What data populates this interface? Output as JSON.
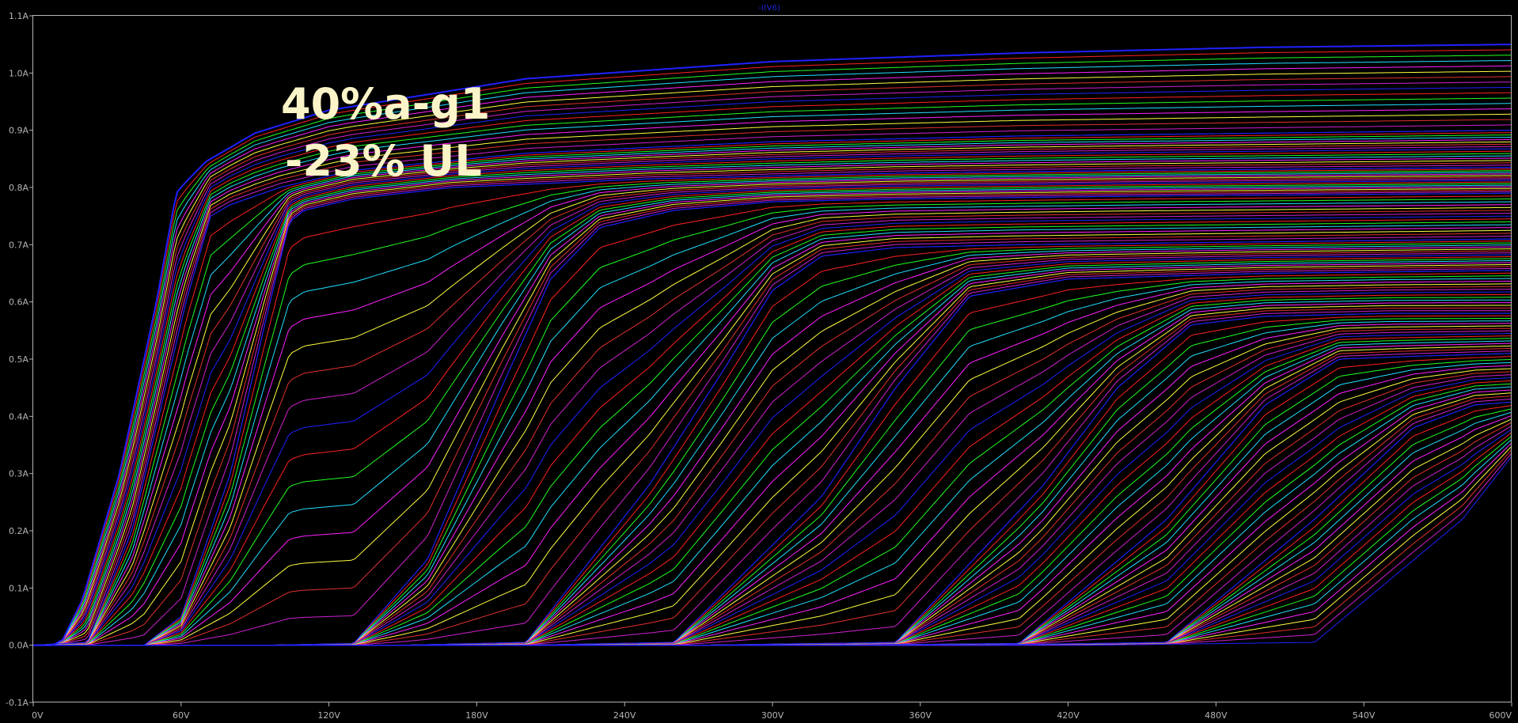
{
  "chart_data": {
    "type": "line",
    "trace_label": "-I(V6)",
    "xlabel": "",
    "ylabel": "",
    "xlim": [
      0,
      600
    ],
    "ylim": [
      -0.1,
      1.1
    ],
    "grid": false,
    "x_ticks": [
      {
        "value": 0,
        "label": "0V"
      },
      {
        "value": 60,
        "label": "60V"
      },
      {
        "value": 120,
        "label": "120V"
      },
      {
        "value": 180,
        "label": "180V"
      },
      {
        "value": 240,
        "label": "240V"
      },
      {
        "value": 300,
        "label": "300V"
      },
      {
        "value": 360,
        "label": "360V"
      },
      {
        "value": 420,
        "label": "420V"
      },
      {
        "value": 480,
        "label": "480V"
      },
      {
        "value": 540,
        "label": "540V"
      },
      {
        "value": 600,
        "label": "600V"
      }
    ],
    "y_ticks": [
      {
        "value": -0.1,
        "label": "-0.1A"
      },
      {
        "value": 0.0,
        "label": "0.0A"
      },
      {
        "value": 0.1,
        "label": "0.1A"
      },
      {
        "value": 0.2,
        "label": "0.2A"
      },
      {
        "value": 0.3,
        "label": "0.3A"
      },
      {
        "value": 0.4,
        "label": "0.4A"
      },
      {
        "value": 0.5,
        "label": "0.5A"
      },
      {
        "value": 0.6,
        "label": "0.6A"
      },
      {
        "value": 0.7,
        "label": "0.7A"
      },
      {
        "value": 0.8,
        "label": "0.8A"
      },
      {
        "value": 0.9,
        "label": "0.9A"
      },
      {
        "value": 1.0,
        "label": "1.0A"
      },
      {
        "value": 1.1,
        "label": "1.1A"
      }
    ],
    "annotations": [
      "40%a-g1",
      "-23% UL"
    ],
    "trace_colors": [
      "#2020ff",
      "#ff2020",
      "#20ff20",
      "#20e0ff",
      "#ff20ff",
      "#ffff40",
      "#e03030",
      "#d020d0"
    ],
    "series": [
      {
        "x": [
          0,
          8,
          12,
          20,
          35,
          50,
          58,
          62,
          70,
          90,
          120,
          200,
          300,
          400,
          500,
          600
        ],
        "y": [
          0,
          0,
          0.01,
          0.08,
          0.3,
          0.6,
          0.79,
          0.81,
          0.845,
          0.895,
          0.935,
          0.99,
          1.02,
          1.035,
          1.045,
          1.05
        ]
      },
      {
        "x": [
          0,
          22,
          40,
          62,
          72,
          80,
          100,
          130,
          200,
          300,
          400,
          500,
          600
        ],
        "y": [
          0,
          0.005,
          0.2,
          0.6,
          0.75,
          0.77,
          0.8,
          0.83,
          0.86,
          0.88,
          0.89,
          0.895,
          0.9
        ]
      },
      {
        "x": [
          0,
          45,
          60,
          80,
          95,
          104,
          110,
          130,
          170,
          250,
          350,
          450,
          600
        ],
        "y": [
          0,
          0,
          0.05,
          0.3,
          0.58,
          0.74,
          0.76,
          0.78,
          0.8,
          0.815,
          0.825,
          0.83,
          0.835
        ]
      },
      {
        "x": [
          0,
          95,
          130,
          160,
          190,
          210,
          230,
          260,
          300,
          350,
          450,
          600
        ],
        "y": [
          0,
          0,
          0.003,
          0.15,
          0.45,
          0.64,
          0.73,
          0.76,
          0.775,
          0.78,
          0.785,
          0.79
        ]
      },
      {
        "x": [
          0,
          150,
          200,
          250,
          280,
          300,
          320,
          350,
          400,
          500,
          600
        ],
        "y": [
          0,
          0,
          0.005,
          0.28,
          0.48,
          0.62,
          0.68,
          0.695,
          0.7,
          0.705,
          0.71
        ]
      },
      {
        "x": [
          0,
          200,
          260,
          320,
          350,
          380,
          420,
          500,
          600
        ],
        "y": [
          0,
          0,
          0.005,
          0.26,
          0.45,
          0.61,
          0.64,
          0.65,
          0.655
        ]
      },
      {
        "x": [
          0,
          270,
          350,
          410,
          440,
          470,
          500,
          550,
          600
        ],
        "y": [
          0,
          0,
          0.005,
          0.28,
          0.45,
          0.56,
          0.575,
          0.58,
          0.58
        ]
      },
      {
        "x": [
          0,
          320,
          400,
          460,
          500,
          530,
          560,
          600
        ],
        "y": [
          0,
          0,
          0.003,
          0.22,
          0.42,
          0.5,
          0.505,
          0.51
        ]
      },
      {
        "x": [
          0,
          380,
          460,
          520,
          560,
          585,
          600
        ],
        "y": [
          0,
          0,
          0.005,
          0.22,
          0.38,
          0.42,
          0.425
        ]
      },
      {
        "x": [
          0,
          430,
          520,
          580,
          600
        ],
        "y": [
          0,
          0,
          0.005,
          0.22,
          0.33
        ]
      }
    ]
  }
}
